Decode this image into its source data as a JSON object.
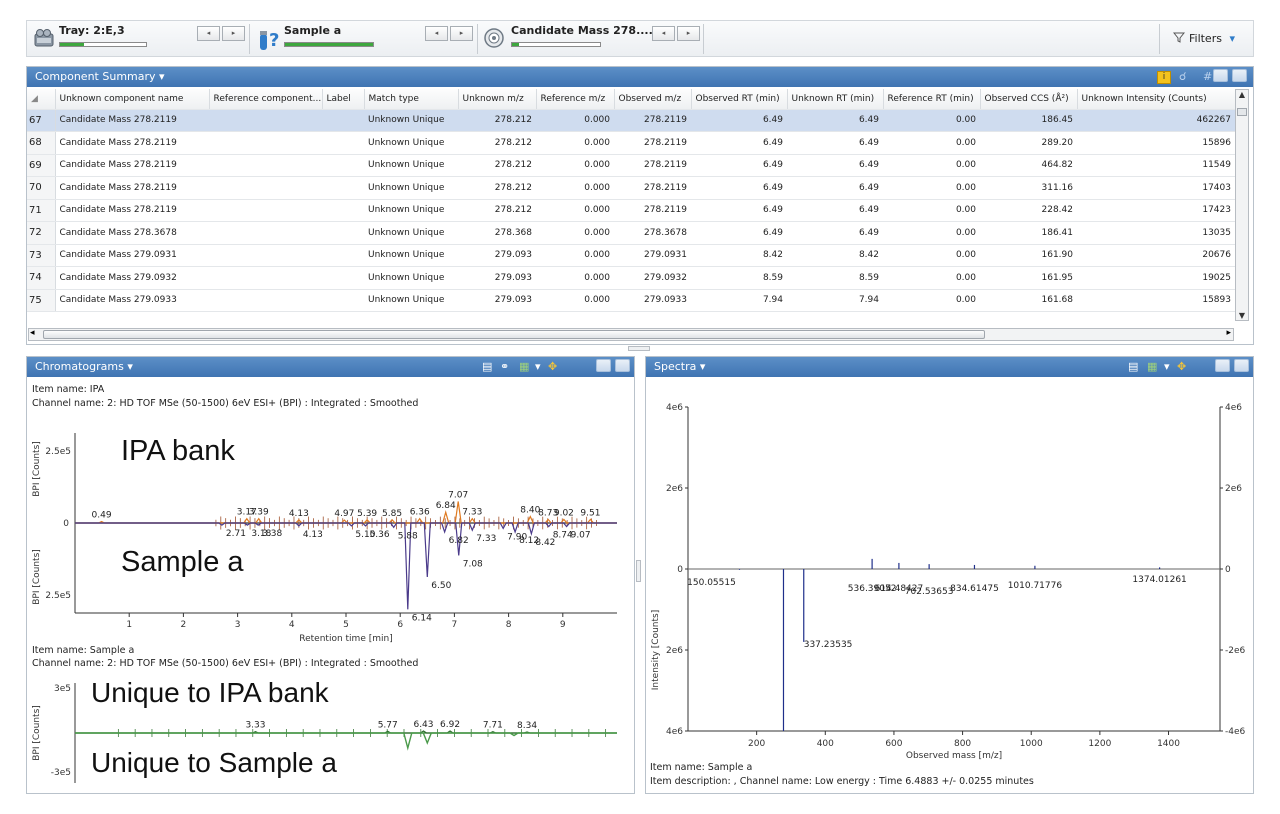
{
  "toolbar": {
    "tray_label": "Tray: 2:E,3",
    "tray_progress": 0.28,
    "sample_label": "Sample a",
    "sample_progress": 1.0,
    "candidate_label": "Candidate Mass 278....",
    "candidate_progress": 0.08,
    "nav_prev": "◂",
    "nav_next": "▸",
    "filters_label": "Filters"
  },
  "component_summary": {
    "title": "Component Summary ▾",
    "columns": [
      "Unknown component name",
      "Reference component...",
      "Label",
      "Match type",
      "Unknown m/z",
      "Reference m/z",
      "Observed m/z",
      "Observed RT (min)",
      "Unknown RT (min)",
      "Reference RT (min)",
      "Observed CCS (Å²)",
      "Unknown Intensity (Counts)"
    ],
    "rows": [
      {
        "n": "67",
        "name": "Candidate Mass 278.2119",
        "ref": "",
        "label": "",
        "match": "Unknown Unique",
        "umz": "278.212",
        "rmz": "0.000",
        "omz": "278.2119",
        "ort": "6.49",
        "urt": "6.49",
        "rrt": "0.00",
        "ccs": "186.45",
        "int": "462267"
      },
      {
        "n": "68",
        "name": "Candidate Mass 278.2119",
        "ref": "",
        "label": "",
        "match": "Unknown Unique",
        "umz": "278.212",
        "rmz": "0.000",
        "omz": "278.2119",
        "ort": "6.49",
        "urt": "6.49",
        "rrt": "0.00",
        "ccs": "289.20",
        "int": "15896"
      },
      {
        "n": "69",
        "name": "Candidate Mass 278.2119",
        "ref": "",
        "label": "",
        "match": "Unknown Unique",
        "umz": "278.212",
        "rmz": "0.000",
        "omz": "278.2119",
        "ort": "6.49",
        "urt": "6.49",
        "rrt": "0.00",
        "ccs": "464.82",
        "int": "11549"
      },
      {
        "n": "70",
        "name": "Candidate Mass 278.2119",
        "ref": "",
        "label": "",
        "match": "Unknown Unique",
        "umz": "278.212",
        "rmz": "0.000",
        "omz": "278.2119",
        "ort": "6.49",
        "urt": "6.49",
        "rrt": "0.00",
        "ccs": "311.16",
        "int": "17403"
      },
      {
        "n": "71",
        "name": "Candidate Mass 278.2119",
        "ref": "",
        "label": "",
        "match": "Unknown Unique",
        "umz": "278.212",
        "rmz": "0.000",
        "omz": "278.2119",
        "ort": "6.49",
        "urt": "6.49",
        "rrt": "0.00",
        "ccs": "228.42",
        "int": "17423"
      },
      {
        "n": "72",
        "name": "Candidate Mass 278.3678",
        "ref": "",
        "label": "",
        "match": "Unknown Unique",
        "umz": "278.368",
        "rmz": "0.000",
        "omz": "278.3678",
        "ort": "6.49",
        "urt": "6.49",
        "rrt": "0.00",
        "ccs": "186.41",
        "int": "13035"
      },
      {
        "n": "73",
        "name": "Candidate Mass 279.0931",
        "ref": "",
        "label": "",
        "match": "Unknown Unique",
        "umz": "279.093",
        "rmz": "0.000",
        "omz": "279.0931",
        "ort": "8.42",
        "urt": "8.42",
        "rrt": "0.00",
        "ccs": "161.90",
        "int": "20676"
      },
      {
        "n": "74",
        "name": "Candidate Mass 279.0932",
        "ref": "",
        "label": "",
        "match": "Unknown Unique",
        "umz": "279.093",
        "rmz": "0.000",
        "omz": "279.0932",
        "ort": "8.59",
        "urt": "8.59",
        "rrt": "0.00",
        "ccs": "161.95",
        "int": "19025"
      },
      {
        "n": "75",
        "name": "Candidate Mass 279.0933",
        "ref": "",
        "label": "",
        "match": "Unknown Unique",
        "umz": "279.093",
        "rmz": "0.000",
        "omz": "279.0933",
        "ort": "7.94",
        "urt": "7.94",
        "rrt": "0.00",
        "ccs": "161.68",
        "int": "15893"
      }
    ]
  },
  "chromatograms": {
    "title": "Chromatograms ▾",
    "item_name_1": "Item name: IPA",
    "channel_1": "Channel name: 2: HD TOF MSe (50-1500) 6eV ESI+ (BPI) : Integrated : Smoothed",
    "item_name_2": "Item name: Sample a",
    "channel_2": "Channel name: 2: HD TOF MSe (50-1500) 6eV ESI+ (BPI) : Integrated : Smoothed",
    "overlay_top": "IPA bank",
    "overlay_bottom": "Sample a",
    "overlay_unique_top": "Unique to IPA bank",
    "overlay_unique_bottom": "Unique to Sample a",
    "ylabel": "BPI [Counts]",
    "xlabel": "Retention time [min]",
    "y_tick_top": "2.5e5",
    "y_tick_zero": "0",
    "y_tick_bottom": "2.5e5",
    "diff_y_top": "3e5",
    "diff_y_bottom": "-3e5"
  },
  "spectra": {
    "title": "Spectra ▾",
    "item_name": "Item name: Sample a",
    "description": "Item description: , Channel name: Low energy : Time 6.4883 +/- 0.0255 minutes",
    "xlabel": "Observed mass [m/z]",
    "ylabel": "Intensity [Counts]"
  },
  "chart_data": [
    {
      "type": "line",
      "title": "",
      "xlabel": "Retention time [min]",
      "ylabel": "BPI [Counts]",
      "xlim": [
        0,
        10
      ],
      "ylim": [
        -250000,
        250000
      ],
      "x_ticks": [
        1,
        2,
        3,
        4,
        5,
        6,
        7,
        8,
        9
      ],
      "series": [
        {
          "name": "IPA bank",
          "x": [
            0.49,
            3.17,
            3.39,
            4.13,
            4.97,
            5.39,
            5.85,
            6.36,
            6.84,
            7.07,
            7.33,
            8.4,
            8.73,
            9.02,
            9.51
          ],
          "values": [
            4000,
            12000,
            12000,
            9000,
            8000,
            9000,
            9000,
            12000,
            30000,
            60000,
            12000,
            18000,
            10000,
            10000,
            10000
          ]
        },
        {
          "name": "Sample a",
          "x": [
            2.71,
            3.18,
            3.38,
            4.13,
            5.1,
            5.36,
            5.88,
            6.14,
            6.5,
            6.82,
            7.08,
            7.33,
            7.9,
            8.12,
            8.42,
            8.74,
            9.07
          ],
          "values": [
            -6000,
            -6000,
            -6000,
            -8000,
            -8000,
            -8000,
            -12000,
            -240000,
            -150000,
            -25000,
            -90000,
            -20000,
            -15000,
            -25000,
            -30000,
            -10000,
            -10000
          ]
        }
      ],
      "peak_labels_top": [
        "0.49",
        "3.17",
        "3.39",
        "4.13",
        "4.97",
        "5.39",
        "5.85",
        "6.36",
        "6.84",
        "7.07",
        "7.33",
        "8.40",
        "8.73",
        "9.02",
        "9.51"
      ],
      "peak_labels_bottom": [
        "2.71",
        "3.18",
        "3.38",
        "4.13",
        "5.10",
        "5.36",
        "5.88",
        "6.14",
        "6.50",
        "6.82",
        "7.08",
        "7.33",
        "7.90",
        "8.12",
        "8.42",
        "8.74",
        "9.07"
      ]
    },
    {
      "type": "line",
      "title": "",
      "ylabel": "BPI [Counts]",
      "xlim": [
        0,
        10
      ],
      "ylim": [
        -300000,
        300000
      ],
      "series": [
        {
          "name": "Unique to IPA bank",
          "x": [
            3.33,
            5.77,
            6.43,
            6.92,
            7.71,
            8.34
          ],
          "values": [
            8000,
            10000,
            12000,
            12000,
            8000,
            6000
          ]
        },
        {
          "name": "Unique to Sample a",
          "x": [
            6.14,
            6.5,
            8.1
          ],
          "values": [
            -90000,
            -60000,
            -15000
          ]
        }
      ],
      "peak_labels": [
        "3.33",
        "5.77",
        "6.43",
        "6.92",
        "7.71",
        "8.34"
      ]
    },
    {
      "type": "bar",
      "title": "",
      "xlabel": "Observed mass [m/z]",
      "ylabel": "Intensity [Counts]",
      "xlim": [
        0,
        1550
      ],
      "ylim": [
        -4000000,
        4000000
      ],
      "x_ticks": [
        200,
        400,
        600,
        800,
        1000,
        1200,
        1400
      ],
      "y_ticks_left": [
        "4e6",
        "2e6",
        "0",
        "2e6",
        "4e6"
      ],
      "y_ticks_right": [
        "4e6",
        "2e6",
        "0",
        "-2e6",
        "-4e6"
      ],
      "peaks": [
        {
          "mz": 150.05515,
          "value": -20000
        },
        {
          "mz": 278.2119,
          "value": -4500000
        },
        {
          "mz": 337.23535,
          "value": -1800000
        },
        {
          "mz": 536.39052,
          "value": 250000
        },
        {
          "mz": 614.48427,
          "value": 150000
        },
        {
          "mz": 702.53653,
          "value": 120000
        },
        {
          "mz": 834.61475,
          "value": 100000
        },
        {
          "mz": 1010.71776,
          "value": 80000
        },
        {
          "mz": 1374.01261,
          "value": 40000
        }
      ],
      "peak_labels": [
        "150.05515",
        "337.23535",
        "536.39052",
        "614.48427",
        "702.53653",
        "834.61475",
        "1010.71776",
        "1374.01261"
      ]
    }
  ]
}
